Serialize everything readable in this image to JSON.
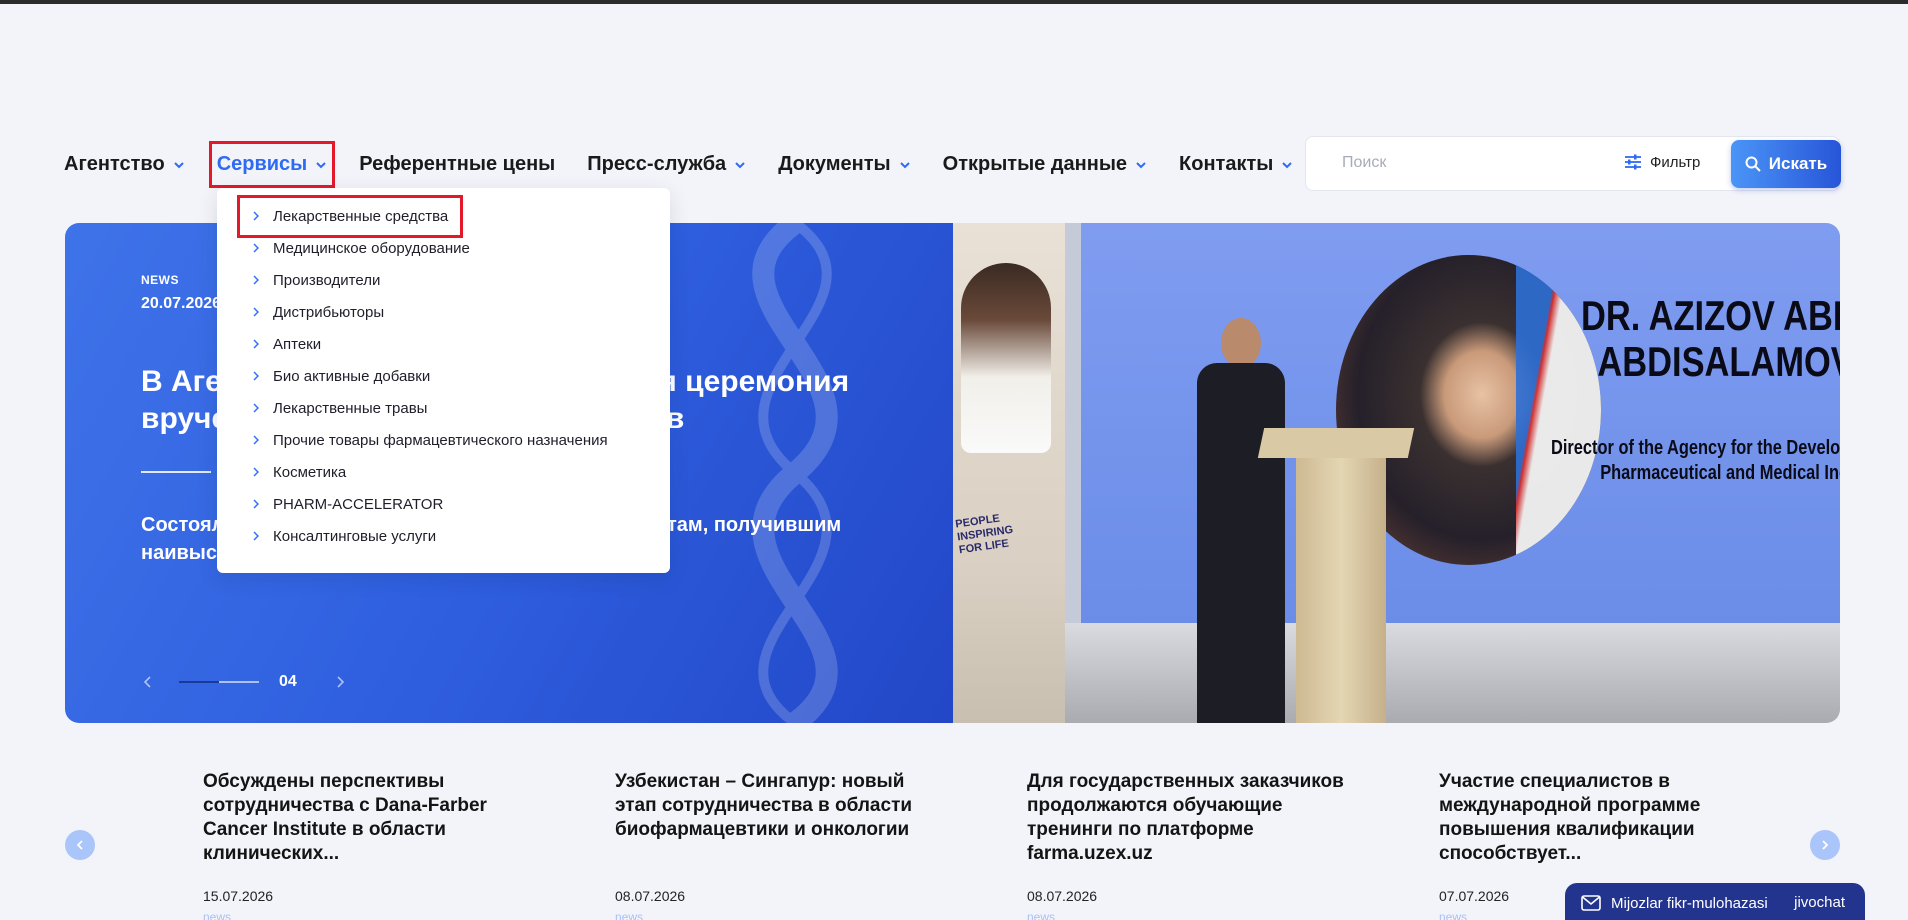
{
  "nav": {
    "items": [
      {
        "label": "Агентство",
        "chevron": true
      },
      {
        "label": "Сервисы",
        "chevron": true,
        "active": true
      },
      {
        "label": "Референтные цены",
        "chevron": false
      },
      {
        "label": "Пресс-служба",
        "chevron": true
      },
      {
        "label": "Документы",
        "chevron": true
      },
      {
        "label": "Открытые данные",
        "chevron": true
      },
      {
        "label": "Контакты",
        "chevron": true
      }
    ]
  },
  "search": {
    "placeholder": "Поиск",
    "filter_label": "Фильтр",
    "button_label": "Искать"
  },
  "dropdown": {
    "items": [
      "Лекарственные средства",
      "Медицинское оборудование",
      "Производители",
      "Дистрибьюторы",
      "Аптеки",
      "Био активные добавки",
      "Лекарственные травы",
      "Прочие товары фармацевтического назначения",
      "Косметика",
      "PHARM-ACCELERATOR",
      "Консалтинговые услуги"
    ]
  },
  "hero": {
    "tag": "NEWS",
    "date": "20.07.2026",
    "title": "В Агентстве прошла торжественная церемония вручения образовательных грантов",
    "description": "Состоялась церемония вручения грантов абитуриентам, получившим наивысшие баллы и...",
    "slide_number": "04",
    "screen_name_line1": "DR. AZIZOV ABDUL",
    "screen_name_line2": "ABDISALAMOVICH",
    "screen_sub_line1": "Director of the Agency for the Develop",
    "screen_sub_line2": "Pharmaceutical and Medical Ind",
    "banner_text": "PEOPLE INSPIRING FOR LIFE"
  },
  "news": [
    {
      "title": "Обсуждены перспективы сотрудничества с Dana-Farber Cancer Institute в области клинических...",
      "date": "15.07.2026",
      "tag": "news"
    },
    {
      "title": "Узбекистан – Сингапур: новый этап сотрудничества в области биофармацевтики и онкологии",
      "date": "08.07.2026",
      "tag": "news"
    },
    {
      "title": "Для государственных заказчиков продолжаются обучающие тренинги по платформе farma.uzex.uz",
      "date": "08.07.2026",
      "tag": "news"
    },
    {
      "title": "Участие специалистов в международной программе повышения квалификации способствует...",
      "date": "07.07.2026",
      "tag": "news"
    }
  ],
  "chat": {
    "label": "Mijozlar fikr-mulohazasi",
    "brand": "jivochat"
  },
  "colors": {
    "accent": "#2e6bf2",
    "highlight_box": "#e3192a",
    "hero_blue": "#2f5fdf",
    "chat_bg": "#23348f"
  }
}
